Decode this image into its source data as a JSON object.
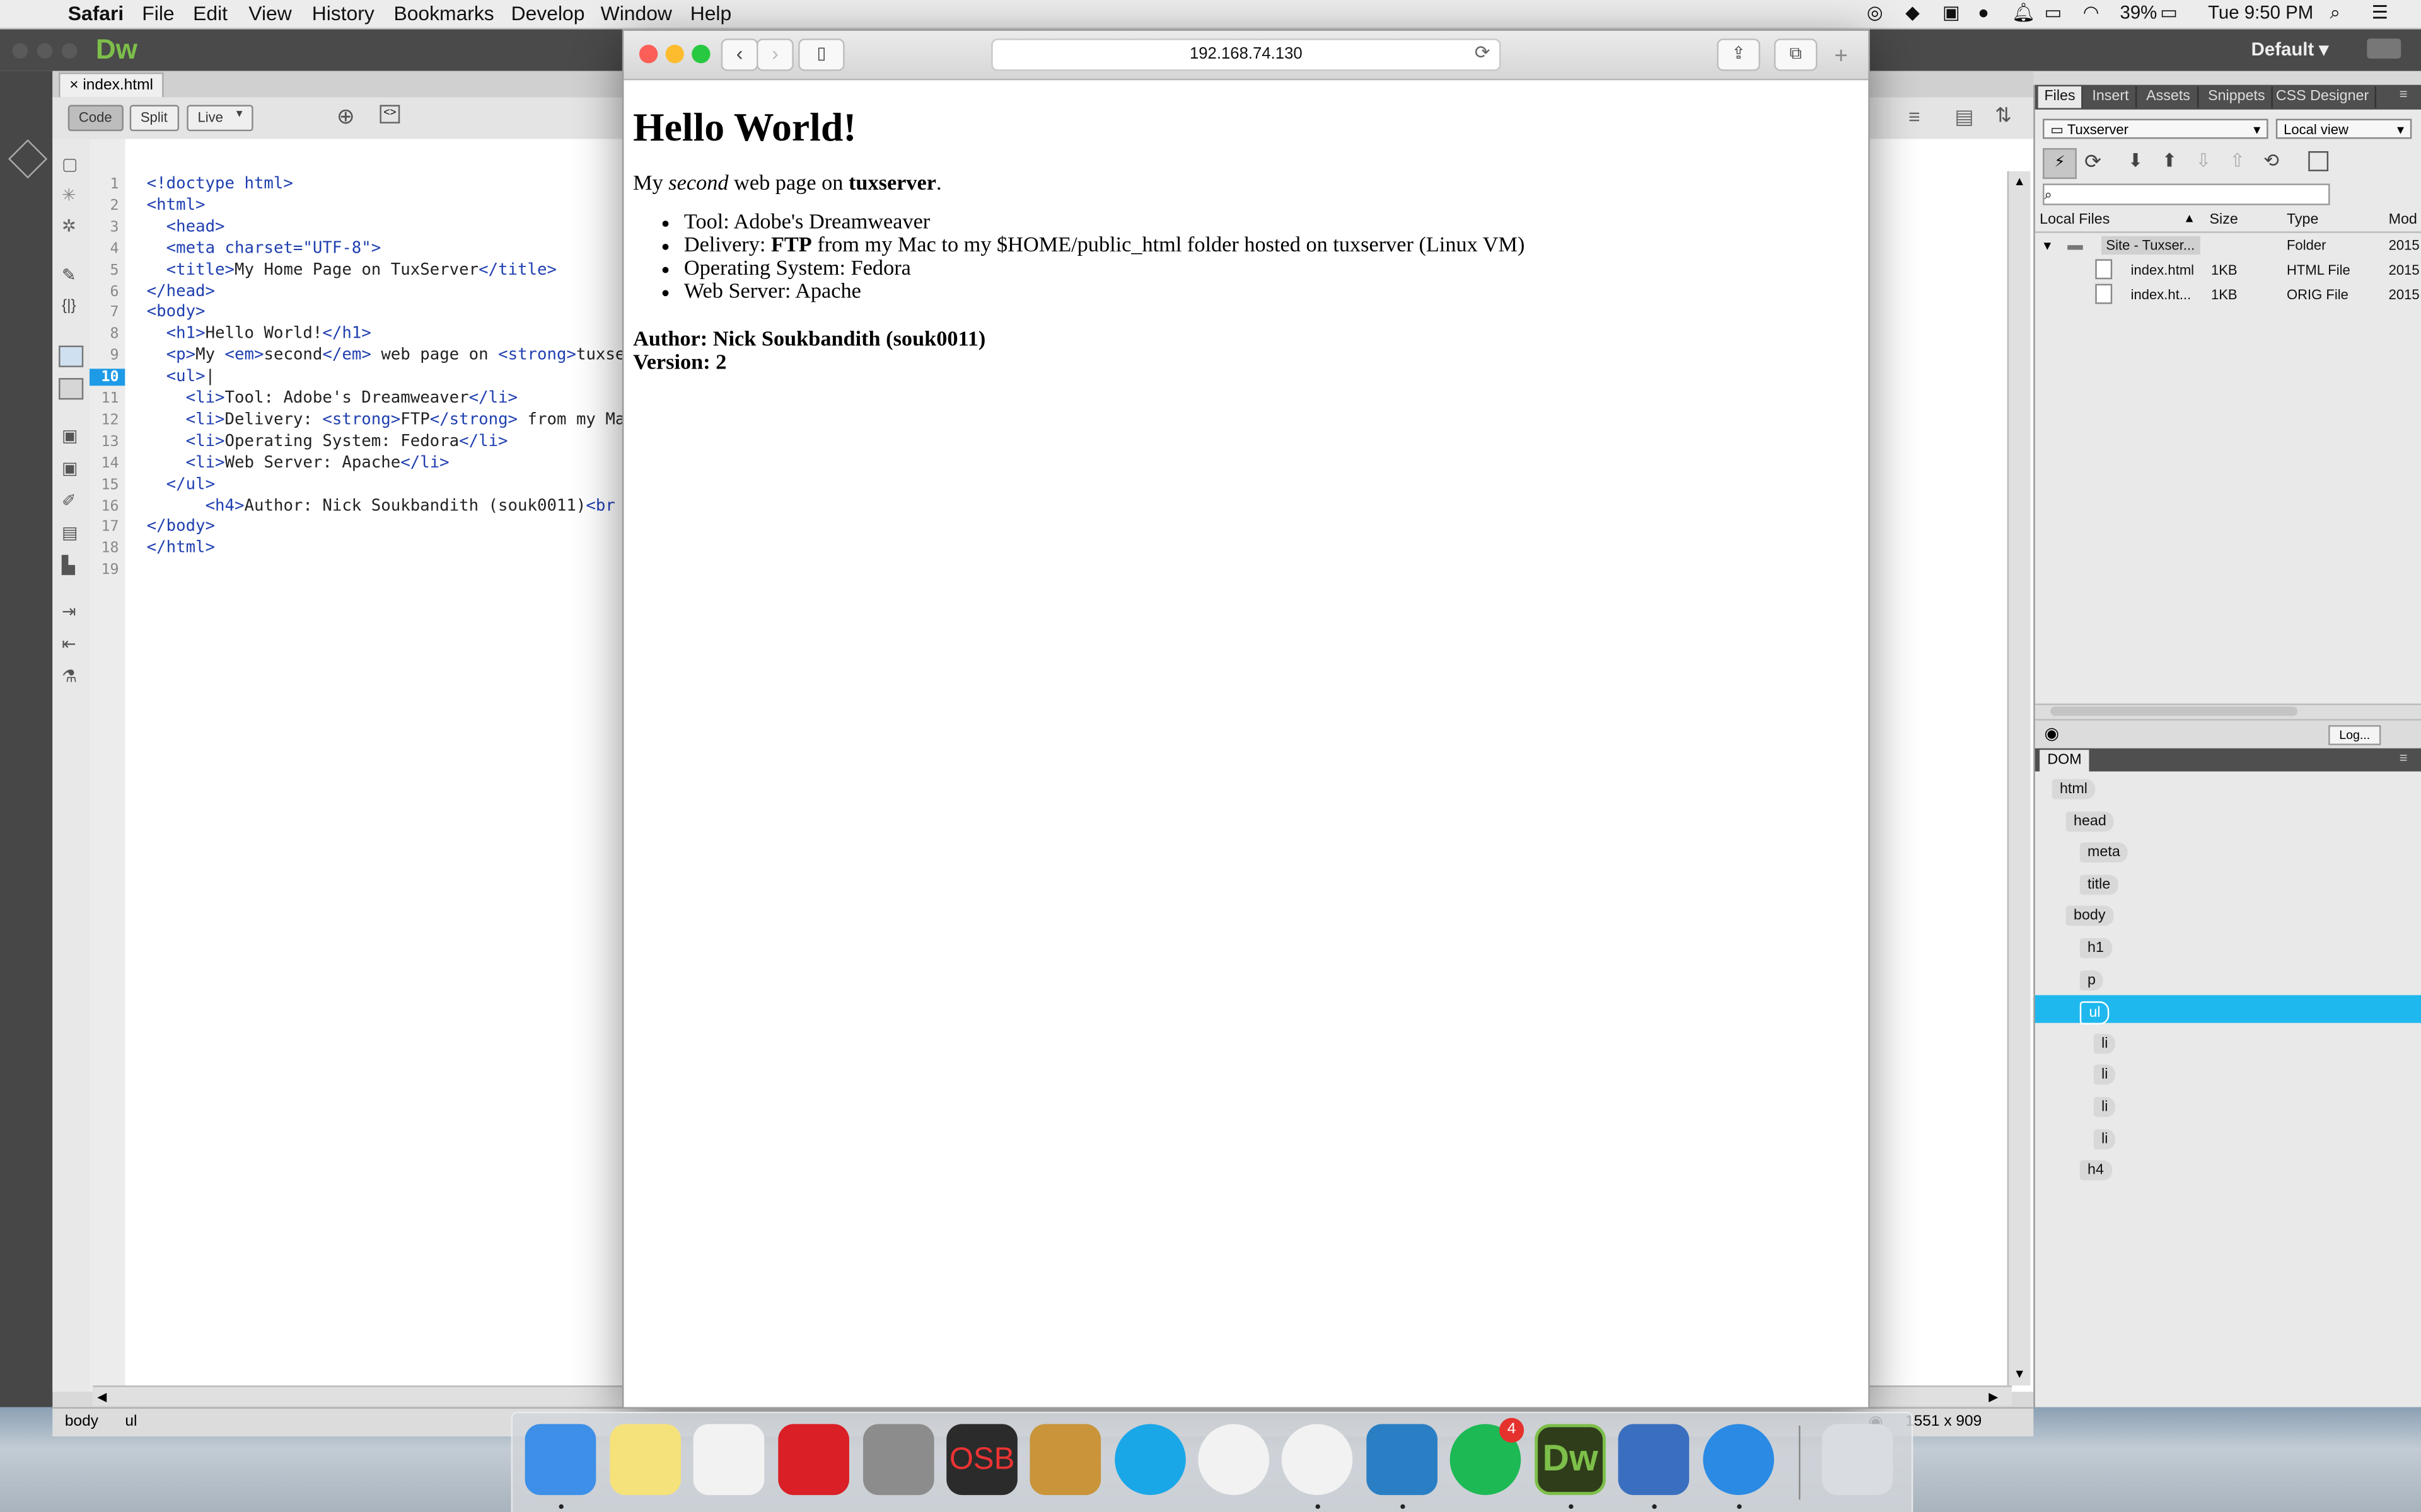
{
  "menubar": {
    "app": "Safari",
    "items": [
      "File",
      "Edit",
      "View",
      "History",
      "Bookmarks",
      "Develop",
      "Window",
      "Help"
    ],
    "battery": "39%",
    "clock": "Tue 9:50 PM"
  },
  "dreamweaver": {
    "logo": "Dw",
    "workspace": "Default",
    "doc_tab": "index.html",
    "view_buttons": {
      "code": "Code",
      "split": "Split",
      "live": "Live"
    },
    "gutter_lines": [
      "1",
      "2",
      "3",
      "4",
      "5",
      "6",
      "7",
      "8",
      "9",
      "10",
      "11",
      "12",
      "13",
      "14",
      "15",
      "16",
      "17",
      "18",
      "19"
    ],
    "current_line": "10",
    "code_lines": [
      [
        {
          "t": "tag",
          "v": "<!doctype html>"
        }
      ],
      [
        {
          "t": "tag",
          "v": "<html>"
        }
      ],
      [
        {
          "t": "",
          "v": "  "
        },
        {
          "t": "tag",
          "v": "<head>"
        }
      ],
      [
        {
          "t": "",
          "v": "  "
        },
        {
          "t": "tag",
          "v": "<meta charset=\"UTF-8\">"
        }
      ],
      [
        {
          "t": "",
          "v": "  "
        },
        {
          "t": "tag",
          "v": "<title>"
        },
        {
          "t": "",
          "v": "My Home Page on TuxServer"
        },
        {
          "t": "tag",
          "v": "</title>"
        }
      ],
      [
        {
          "t": "tag",
          "v": "</head>"
        }
      ],
      [
        {
          "t": "tag",
          "v": "<body>"
        }
      ],
      [
        {
          "t": "",
          "v": "  "
        },
        {
          "t": "tag",
          "v": "<h1>"
        },
        {
          "t": "",
          "v": "Hello World!"
        },
        {
          "t": "tag",
          "v": "</h1>"
        }
      ],
      [
        {
          "t": "",
          "v": "  "
        },
        {
          "t": "tag",
          "v": "<p>"
        },
        {
          "t": "",
          "v": "My "
        },
        {
          "t": "tag",
          "v": "<em>"
        },
        {
          "t": "",
          "v": "second"
        },
        {
          "t": "tag",
          "v": "</em>"
        },
        {
          "t": "",
          "v": " web page on "
        },
        {
          "t": "tag",
          "v": "<strong>"
        },
        {
          "t": "",
          "v": "tuxser"
        }
      ],
      [
        {
          "t": "",
          "v": "  "
        },
        {
          "t": "tag",
          "v": "<ul>"
        },
        {
          "t": "",
          "v": "|"
        }
      ],
      [
        {
          "t": "",
          "v": "    "
        },
        {
          "t": "tag",
          "v": "<li>"
        },
        {
          "t": "",
          "v": "Tool: Adobe's Dreamweaver"
        },
        {
          "t": "tag",
          "v": "</li>"
        }
      ],
      [
        {
          "t": "",
          "v": "    "
        },
        {
          "t": "tag",
          "v": "<li>"
        },
        {
          "t": "",
          "v": "Delivery: "
        },
        {
          "t": "tag",
          "v": "<strong>"
        },
        {
          "t": "",
          "v": "FTP"
        },
        {
          "t": "tag",
          "v": "</strong>"
        },
        {
          "t": "",
          "v": " from my Ma"
        }
      ],
      [
        {
          "t": "",
          "v": "    "
        },
        {
          "t": "tag",
          "v": "<li>"
        },
        {
          "t": "",
          "v": "Operating System: Fedora"
        },
        {
          "t": "tag",
          "v": "</li>"
        }
      ],
      [
        {
          "t": "",
          "v": "    "
        },
        {
          "t": "tag",
          "v": "<li>"
        },
        {
          "t": "",
          "v": "Web Server: Apache"
        },
        {
          "t": "tag",
          "v": "</li>"
        }
      ],
      [
        {
          "t": "",
          "v": "  "
        },
        {
          "t": "tag",
          "v": "</ul>"
        }
      ],
      [
        {
          "t": "",
          "v": "      "
        },
        {
          "t": "tag",
          "v": "<h4>"
        },
        {
          "t": "",
          "v": "Author: Nick Soukbandith (souk0011)"
        },
        {
          "t": "tag",
          "v": "<br"
        }
      ],
      [
        {
          "t": "tag",
          "v": "</body>"
        }
      ],
      [
        {
          "t": "tag",
          "v": "</html>"
        }
      ],
      []
    ],
    "status_tags": [
      "body",
      "ul"
    ],
    "status_size": "1551 x 909"
  },
  "files_panel": {
    "tabs": [
      "Files",
      "Insert",
      "Assets",
      "Snippets",
      "CSS Designer"
    ],
    "site_select": "Tuxserver",
    "view_select": "Local view",
    "log_button": "Log...",
    "columns": [
      "Local Files",
      "Size",
      "Type",
      "Mod"
    ],
    "rows": [
      {
        "name": "Site - Tuxser...",
        "size": "",
        "type": "Folder",
        "mod": "2015"
      },
      {
        "name": "index.html",
        "size": "1KB",
        "type": "HTML File",
        "mod": "2015"
      },
      {
        "name": "index.ht...",
        "size": "1KB",
        "type": "ORIG File",
        "mod": "2015"
      }
    ]
  },
  "dom_panel": {
    "tab": "DOM",
    "nodes": [
      "html",
      "head",
      "meta",
      "title",
      "body",
      "h1",
      "p",
      "ul",
      "li",
      "li",
      "li",
      "li",
      "h4"
    ]
  },
  "safari": {
    "url": "192.168.74.130",
    "page": {
      "h1": "Hello World!",
      "p_pre": "My ",
      "p_em": "second",
      "p_mid": " web page on ",
      "p_strong": "tuxserver",
      "p_post": ".",
      "li1": "Tool: Adobe's Dreamweaver",
      "li2_pre": "Delivery: ",
      "li2_strong": "FTP",
      "li2_post": " from my Mac to my $HOME/public_html folder hosted on tuxserver (Linux VM)",
      "li3": "Operating System: Fedora",
      "li4": "Web Server: Apache",
      "author": "Author: Nick Soukbandith (souk0011)",
      "version": "Version: 2"
    }
  },
  "dock": {
    "apps": [
      {
        "name": "finder-icon",
        "color": "#3d8fe8"
      },
      {
        "name": "notes-icon",
        "color": "#f6e27a"
      },
      {
        "name": "photos-icon",
        "color": "#f2f2f2"
      },
      {
        "name": "creative-cloud-icon",
        "color": "#da1f26"
      },
      {
        "name": "system-preferences-icon",
        "color": "#8c8c8c"
      },
      {
        "name": "osb-icon",
        "color": "#2b2b2b"
      },
      {
        "name": "hearthstone-icon",
        "color": "#c9943a"
      },
      {
        "name": "skype-icon",
        "color": "#1aa7e8"
      },
      {
        "name": "itunes-icon",
        "color": "#f2f2f2"
      },
      {
        "name": "chrome-icon",
        "color": "#f2f2f2"
      },
      {
        "name": "parallels-icon",
        "color": "#2a7fc4"
      },
      {
        "name": "spotify-icon",
        "color": "#1db954"
      },
      {
        "name": "dreamweaver-icon",
        "color": "#2f3d1a"
      },
      {
        "name": "vmware-fusion-icon",
        "color": "#3a6fc0"
      },
      {
        "name": "safari-icon",
        "color": "#2a8ae4"
      },
      {
        "name": "trash-icon",
        "color": "#d9dde1"
      }
    ],
    "spotify_badge": "4",
    "dw_text": "Dw",
    "osb_text": "OSB"
  }
}
